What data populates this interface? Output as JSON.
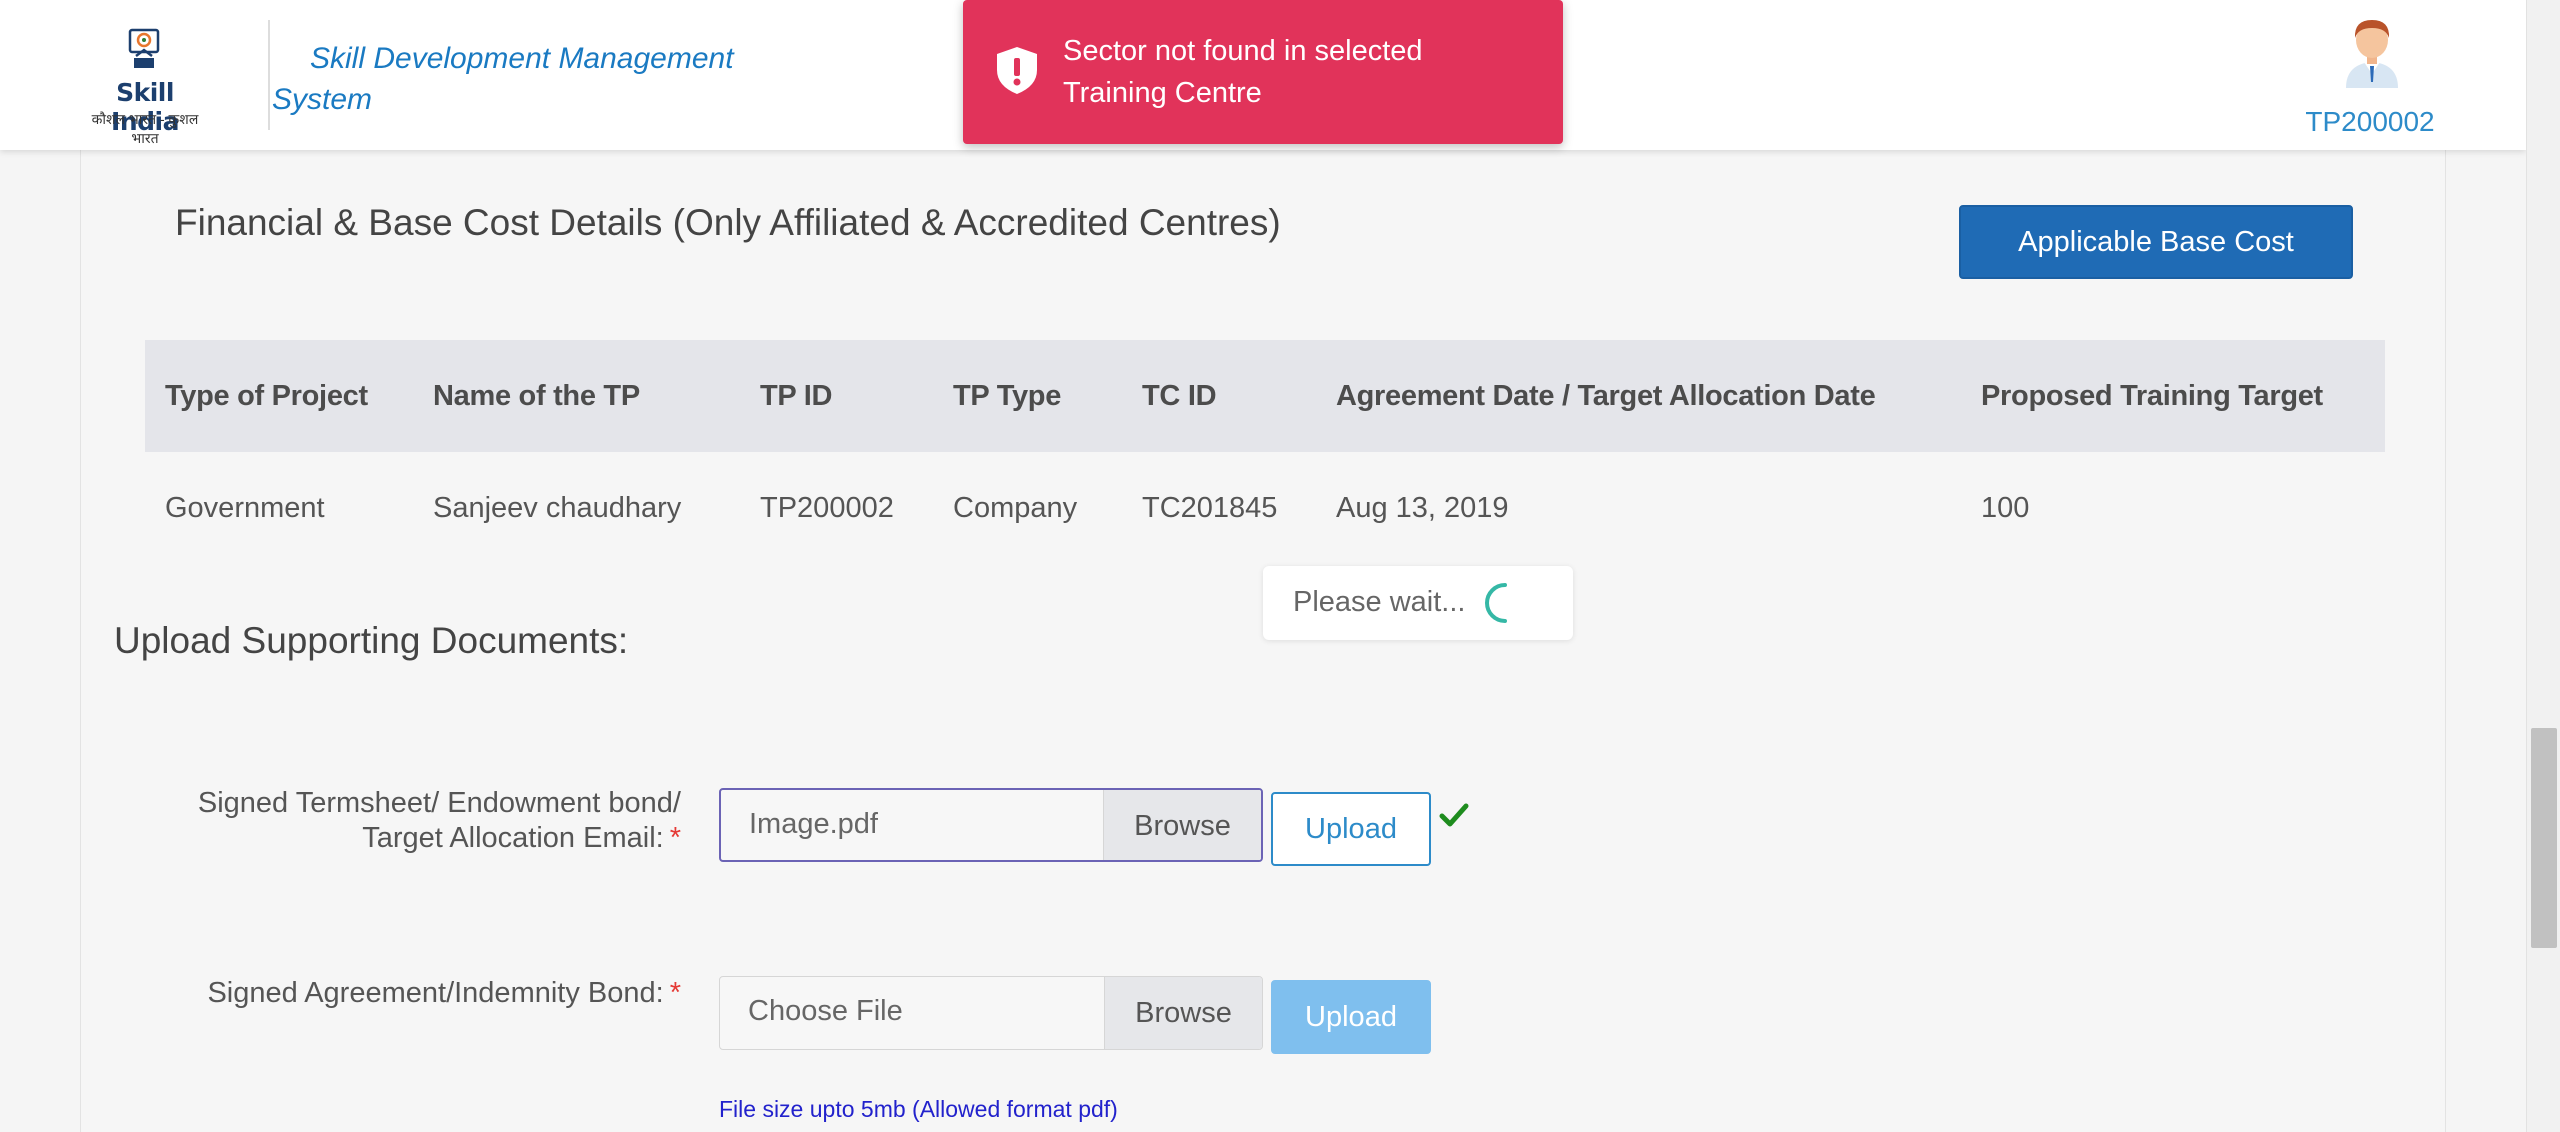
{
  "header": {
    "logo_text": "Skill India",
    "logo_tagline": "कौशल भारत - कुशल भारत",
    "app_title": "Skill Development Management System",
    "user_id": "TP200002"
  },
  "toast": {
    "message": "Sector not found in selected Training Centre",
    "icon": "shield-exclamation-icon",
    "color": "#e1335a"
  },
  "financial": {
    "title": "Financial & Base Cost Details (Only Affiliated & Accredited Centres)",
    "base_cost_button": "Applicable Base Cost",
    "columns": [
      "Type of Project",
      "Name of the TP",
      "TP ID",
      "TP Type",
      "TC ID",
      "Agreement Date / Target Allocation Date",
      "Proposed Training Target"
    ],
    "rows": [
      [
        "Government",
        "Sanjeev chaudhary",
        "TP200002",
        "Company",
        "TC201845",
        "Aug 13, 2019",
        "100"
      ]
    ]
  },
  "loader": {
    "text": "Please wait..."
  },
  "upload": {
    "title": "Upload Supporting Documents:",
    "fields": [
      {
        "label_line1": "Signed Termsheet/ Endowment bond/",
        "label_line2": "Target Allocation Email:",
        "required_mark": "*",
        "file_value": "Image.pdf",
        "browse_label": "Browse",
        "upload_label": "Upload",
        "uploaded": true
      },
      {
        "label_line1": "Signed Agreement/Indemnity Bond:",
        "required_mark": "*",
        "file_placeholder": "Choose File",
        "browse_label": "Browse",
        "upload_label": "Upload",
        "uploaded": false
      }
    ],
    "hint": "File size upto 5mb (Allowed format pdf)"
  },
  "colors": {
    "primary": "#1f6bb5",
    "link": "#2d8bc9",
    "success": "#1e8c1e",
    "required": "#e53935"
  }
}
